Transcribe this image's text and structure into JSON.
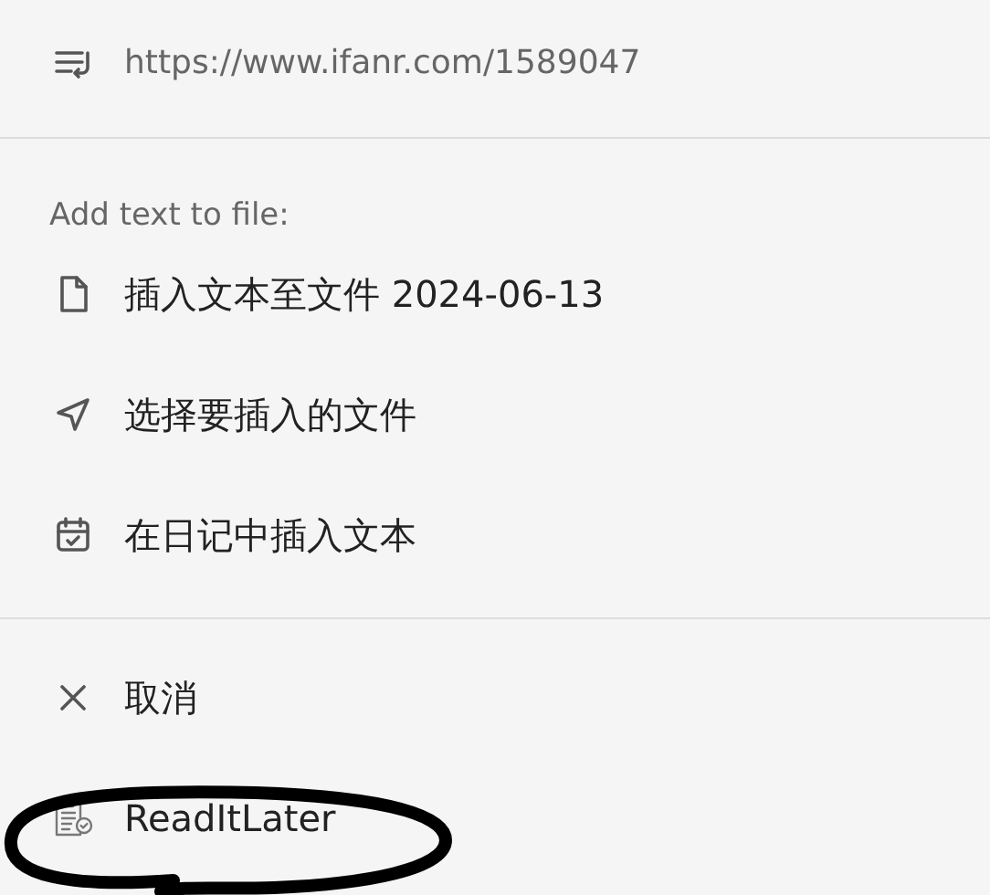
{
  "url_row": {
    "text": "https://www.ifanr.com/1589047"
  },
  "section_label": "Add text to file:",
  "file_actions": [
    {
      "kind": "file",
      "label": "插入文本至文件 2024-06-13"
    },
    {
      "kind": "send",
      "label": "选择要插入的文件"
    },
    {
      "kind": "calendar",
      "label": "在日记中插入文本"
    }
  ],
  "other_actions": [
    {
      "kind": "close",
      "label": "取消"
    },
    {
      "kind": "clipboard",
      "label": "ReadItLater",
      "circled": true
    }
  ]
}
